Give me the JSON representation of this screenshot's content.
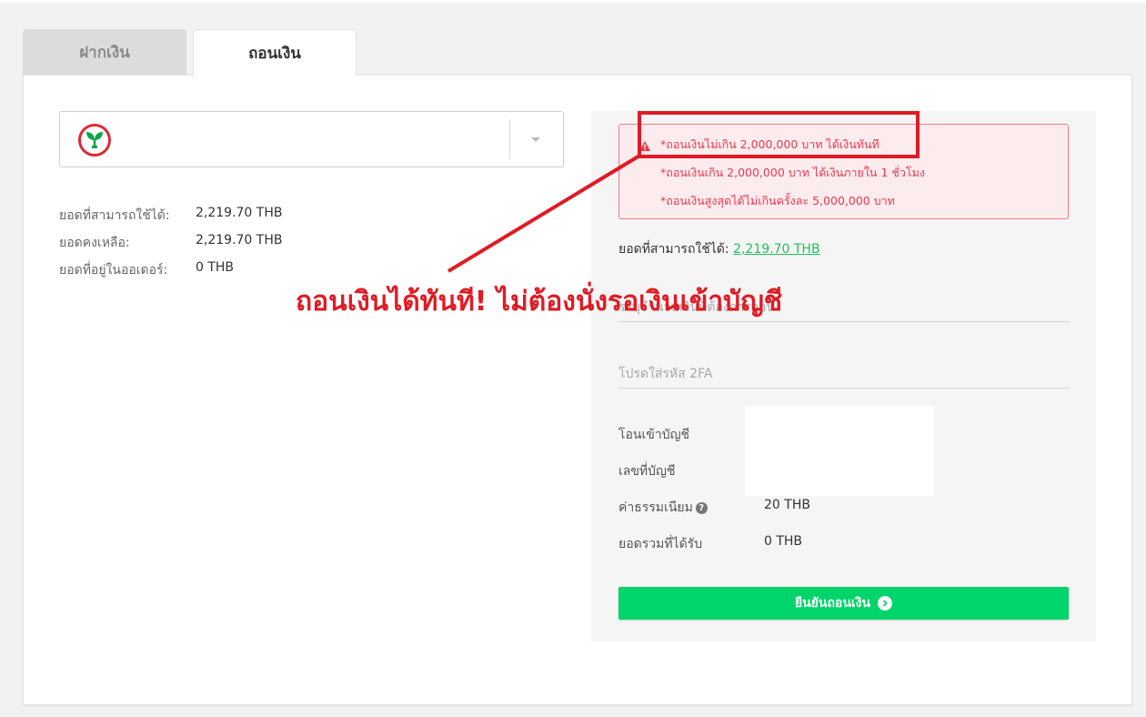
{
  "tabs": [
    {
      "label": "ฝากเงิน",
      "active": false
    },
    {
      "label": "ถอนเงิน",
      "active": true
    }
  ],
  "bank_select": {
    "logo_icon": "kasikorn-bank-logo",
    "value": ""
  },
  "balances": [
    {
      "label": "ยอดที่สามารถใช้ได้:",
      "value": "2,219.70 THB"
    },
    {
      "label": "ยอดคงเหลือ:",
      "value": "2,219.70 THB"
    },
    {
      "label": "ยอดที่อยู่ในออเดอร์:",
      "value": "0 THB"
    }
  ],
  "alert": {
    "lines": [
      "*ถอนเงินไม่เกิน 2,000,000 บาท ได้เงินทันที",
      "*ถอนเงินเกิน 2,000,000 บาท ได้เงินภายใน 1 ชั่วโมง",
      "*ถอนเงินสูงสุดได้ไม่เกินครั้งละ 5,000,000 บาท"
    ],
    "color": "#e8384f"
  },
  "available": {
    "label": "ยอดที่สามารถใช้ได้:",
    "value": "2,219.70 THB"
  },
  "inputs": {
    "amount_placeholder": "ระบุจำนวนเงินที่ต้องการถอน",
    "twofa_placeholder": "โปรดใส่รหัส 2FA"
  },
  "details": {
    "transfer_to_label": "โอนเข้าบัญชี",
    "account_no_label": "เลขที่บัญชี",
    "fee_label": "ค่าธรรมเนียม",
    "fee_value": "20 THB",
    "total_label": "ยอดรวมที่ได้รับ",
    "total_value": "0 THB"
  },
  "confirm_button": {
    "label": "ยืนยันถอนเงิน",
    "color": "#00d46a"
  },
  "annotation": {
    "text": "ถอนเงินได้ทันที! ไม่ต้องนั่งรอเงินเข้าบัญชี",
    "color": "#e01b24"
  }
}
